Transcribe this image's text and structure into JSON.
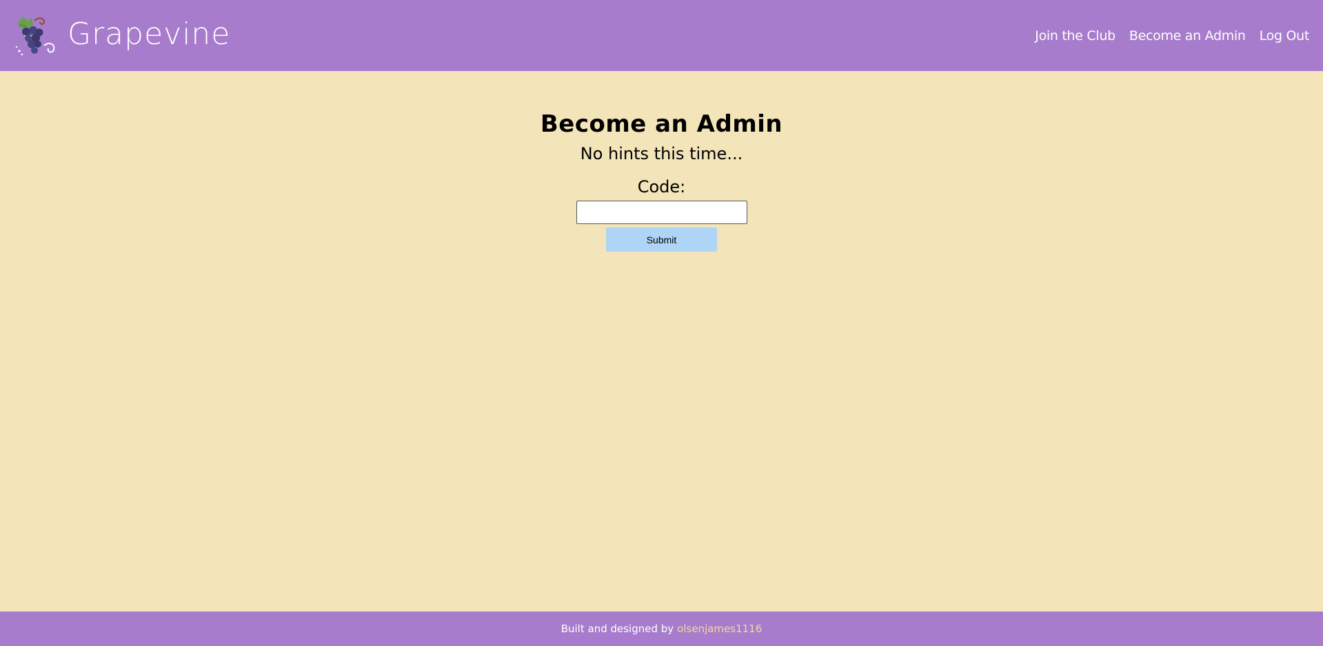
{
  "header": {
    "logo_text": "Grapevine",
    "logo_icon": "grape-cluster-icon",
    "nav": [
      {
        "label": "Join the Club"
      },
      {
        "label": "Become an Admin"
      },
      {
        "label": "Log Out"
      }
    ]
  },
  "main": {
    "title": "Become an Admin",
    "subtitle": "No hints this time...",
    "code_label": "Code:",
    "code_value": "",
    "submit_label": "Submit"
  },
  "footer": {
    "text": "Built and designed by",
    "author": "olsenjames1116"
  },
  "colors": {
    "header_bg": "#a77ccc",
    "page_bg": "#f3e4b9",
    "submit_bg": "#aed4f6",
    "footer_link": "#f7d79a"
  }
}
